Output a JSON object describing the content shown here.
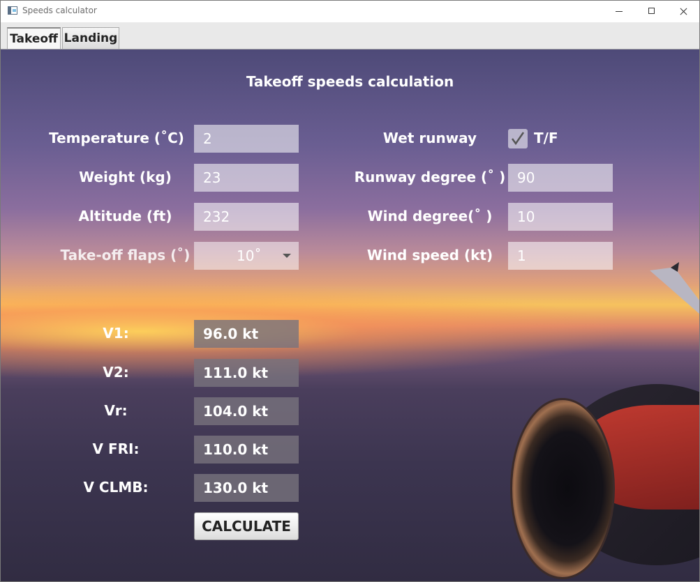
{
  "window": {
    "title": "Speeds calculator"
  },
  "tabs": [
    {
      "label": "Takeoff"
    },
    {
      "label": "Landing"
    }
  ],
  "page_title": "Takeoff speeds calculation",
  "inputs": {
    "temperature": {
      "label": "Temperature (˚C)",
      "value": "2"
    },
    "weight": {
      "label": "Weight (kg)",
      "value": "23"
    },
    "altitude": {
      "label": "Altitude (ft)",
      "value": "232"
    },
    "flaps": {
      "label": "Take-off flaps (˚)",
      "value": "10˚"
    },
    "wet_runway": {
      "label": "Wet runway",
      "checkbox_label": "T/F",
      "checked": true
    },
    "runway_degree": {
      "label": "Runway degree (˚ )",
      "value": "90"
    },
    "wind_degree": {
      "label": "Wind degree(˚ )",
      "value": "10"
    },
    "wind_speed": {
      "label": "Wind speed (kt)",
      "value": "1"
    }
  },
  "results": {
    "v1": {
      "label": "V1:",
      "value": "96.0 kt"
    },
    "v2": {
      "label": "V2:",
      "value": "111.0 kt"
    },
    "vr": {
      "label": "Vr:",
      "value": "104.0 kt"
    },
    "vfri": {
      "label": "V FRI:",
      "value": "110.0 kt"
    },
    "vclmb": {
      "label": "V CLMB:",
      "value": "130.0 kt"
    }
  },
  "calculate_label": "CALCULATE",
  "icons": [
    "app-icon",
    "minimize-icon",
    "maximize-icon",
    "close-icon",
    "chevron-down-icon",
    "checkmark-icon"
  ]
}
